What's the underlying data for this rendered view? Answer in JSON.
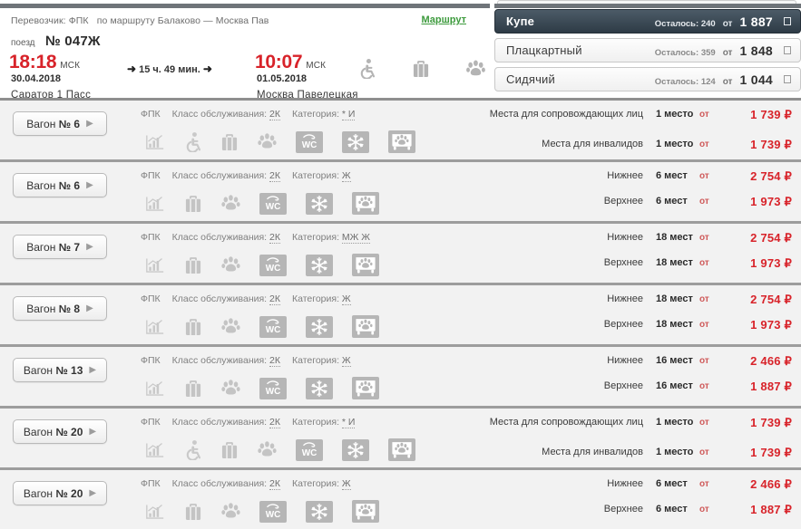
{
  "header": {
    "carrier_prefix": "Перевозчик:",
    "carrier": "ФПК",
    "route_prefix": "по маршруту",
    "route": "Балаково — Москва Пав",
    "route_link": "Маршрут",
    "train_label": "поезд",
    "train_number": "№ 047Ж",
    "departure_time": "18:18",
    "departure_tz": "МСК",
    "departure_date": "30.04.2018",
    "departure_station": "Саратов 1 Пасс",
    "duration": "15 ч. 49 мин.",
    "arrival_time": "10:07",
    "arrival_tz": "МСК",
    "arrival_date": "01.05.2018",
    "arrival_station": "Москва Павелецкая",
    "icons": [
      "wheelchair-icon",
      "luggage-icon",
      "pet-paw-icon"
    ]
  },
  "classes": [
    {
      "name": "Купе",
      "left_label": "Осталось: 240",
      "from_label": "от",
      "price": "1 887",
      "selected": true
    },
    {
      "name": "Плацкартный",
      "left_label": "Осталось: 359",
      "from_label": "от",
      "price": "1 848",
      "selected": false
    },
    {
      "name": "Сидячий",
      "left_label": "Осталось: 124",
      "from_label": "от",
      "price": "1 044",
      "selected": false
    }
  ],
  "labels": {
    "wagon_prefix": "Вагон",
    "carrier": "ФПК",
    "service_class_label": "Класс обслуживания:",
    "category_label": "Категория:",
    "from": "от",
    "currency": "₽"
  },
  "wagons": [
    {
      "number": "№ 6",
      "service_class": "2К",
      "category": "* И",
      "icons": [
        "signal-icon",
        "wheelchair-icon",
        "luggage-icon",
        "pet-paw-icon",
        "wc-icon",
        "air-conditioning-icon",
        "pet-carrier-icon"
      ],
      "seats": [
        {
          "type": "Места для сопровождающих лиц",
          "count": "1 место",
          "from": "от",
          "price": "1 739 ₽",
          "wrap": true
        },
        {
          "type": "Места для инвалидов",
          "count": "1 место",
          "from": "от",
          "price": "1 739 ₽",
          "wrap": false
        }
      ]
    },
    {
      "number": "№ 6",
      "service_class": "2К",
      "category": "Ж",
      "icons": [
        "signal-icon",
        "luggage-icon",
        "pet-paw-icon",
        "wc-icon",
        "air-conditioning-icon",
        "pet-carrier-icon"
      ],
      "seats": [
        {
          "type": "Нижнее",
          "count": "6 мест",
          "from": "от",
          "price": "2 754 ₽",
          "wrap": false
        },
        {
          "type": "Верхнее",
          "count": "6 мест",
          "from": "от",
          "price": "1 973 ₽",
          "wrap": false
        }
      ]
    },
    {
      "number": "№ 7",
      "service_class": "2К",
      "category": "МЖ Ж",
      "icons": [
        "signal-icon",
        "luggage-icon",
        "pet-paw-icon",
        "wc-icon",
        "air-conditioning-icon",
        "pet-carrier-icon"
      ],
      "seats": [
        {
          "type": "Нижнее",
          "count": "18 мест",
          "from": "от",
          "price": "2 754 ₽",
          "wrap": false
        },
        {
          "type": "Верхнее",
          "count": "18 мест",
          "from": "от",
          "price": "1 973 ₽",
          "wrap": false
        }
      ]
    },
    {
      "number": "№ 8",
      "service_class": "2К",
      "category": "Ж",
      "icons": [
        "signal-icon",
        "luggage-icon",
        "pet-paw-icon",
        "wc-icon",
        "air-conditioning-icon",
        "pet-carrier-icon"
      ],
      "seats": [
        {
          "type": "Нижнее",
          "count": "18 мест",
          "from": "от",
          "price": "2 754 ₽",
          "wrap": false
        },
        {
          "type": "Верхнее",
          "count": "18 мест",
          "from": "от",
          "price": "1 973 ₽",
          "wrap": false
        }
      ]
    },
    {
      "number": "№ 13",
      "service_class": "2К",
      "category": "Ж",
      "icons": [
        "signal-icon",
        "luggage-icon",
        "pet-paw-icon",
        "wc-icon",
        "air-conditioning-icon",
        "pet-carrier-icon"
      ],
      "seats": [
        {
          "type": "Нижнее",
          "count": "16 мест",
          "from": "от",
          "price": "2 466 ₽",
          "wrap": false
        },
        {
          "type": "Верхнее",
          "count": "16 мест",
          "from": "от",
          "price": "1 887 ₽",
          "wrap": false
        }
      ]
    },
    {
      "number": "№ 20",
      "service_class": "2К",
      "category": "* И",
      "icons": [
        "signal-icon",
        "wheelchair-icon",
        "luggage-icon",
        "pet-paw-icon",
        "wc-icon",
        "air-conditioning-icon",
        "pet-carrier-icon"
      ],
      "seats": [
        {
          "type": "Места для сопровождающих лиц",
          "count": "1 место",
          "from": "от",
          "price": "1 739 ₽",
          "wrap": true
        },
        {
          "type": "Места для инвалидов",
          "count": "1 место",
          "from": "от",
          "price": "1 739 ₽",
          "wrap": false
        }
      ]
    },
    {
      "number": "№ 20",
      "service_class": "2К",
      "category": "Ж",
      "icons": [
        "signal-icon",
        "luggage-icon",
        "pet-paw-icon",
        "wc-icon",
        "air-conditioning-icon",
        "pet-carrier-icon"
      ],
      "seats": [
        {
          "type": "Нижнее",
          "count": "6 мест",
          "from": "от",
          "price": "2 466 ₽",
          "wrap": false
        },
        {
          "type": "Верхнее",
          "count": "6 мест",
          "from": "от",
          "price": "1 887 ₽",
          "wrap": false
        }
      ]
    }
  ]
}
